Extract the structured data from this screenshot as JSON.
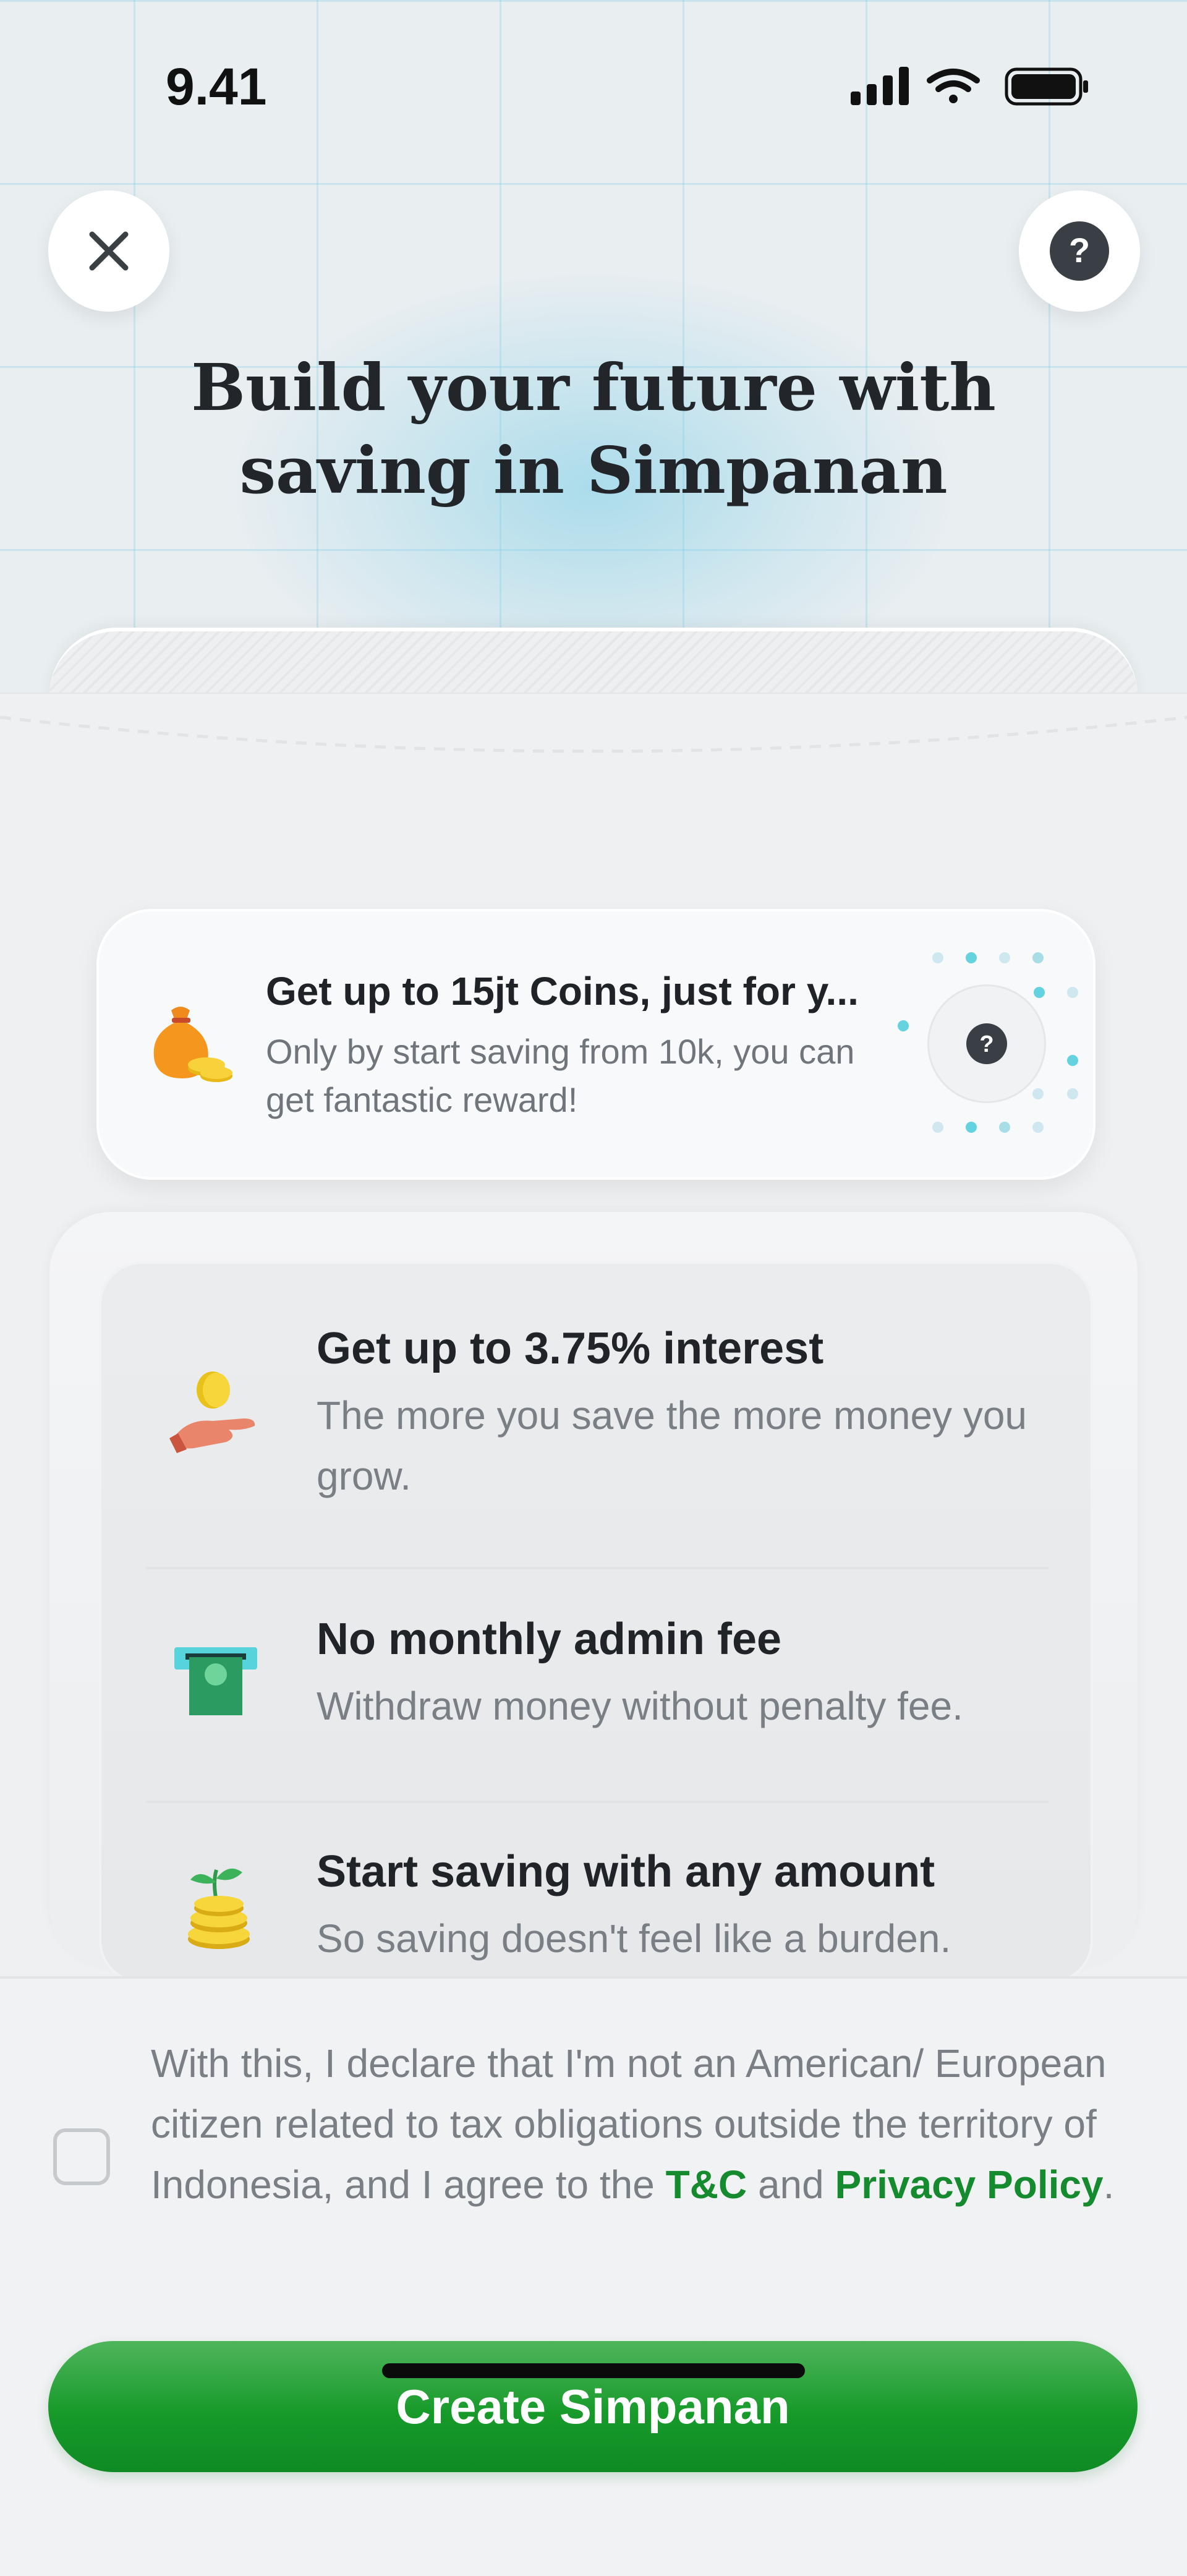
{
  "status_bar": {
    "time": "9.41"
  },
  "header": {
    "title": "Build your future with saving in Simpanan"
  },
  "reward": {
    "title": "Get up to 15jt Coins, just for y...",
    "description": "Only by start saving from 10k, you can get fantastic reward!"
  },
  "benefits": [
    {
      "title": "Get up to 3.75% interest",
      "description": "The more you save the more money you grow.",
      "icon": "hand-coin-icon"
    },
    {
      "title": "No monthly admin fee",
      "description": "Withdraw money without penalty fee.",
      "icon": "cash-withdraw-icon"
    },
    {
      "title": "Start saving with any amount",
      "description": "So saving doesn't feel like a burden.",
      "icon": "coin-plant-icon"
    }
  ],
  "declaration": {
    "text_before": "With this, I declare that I'm not an American/ European citizen related to tax obligations outside the territory of Indonesia, and I agree to the ",
    "tnc_link": "T&C",
    "text_and": " and ",
    "privacy_link": "Privacy Policy",
    "text_end": "."
  },
  "cta": {
    "label": "Create Simpanan"
  },
  "colors": {
    "brand_green": "#179a2a",
    "link_green": "#168a2f",
    "accent_teal": "#4fcfdc"
  }
}
